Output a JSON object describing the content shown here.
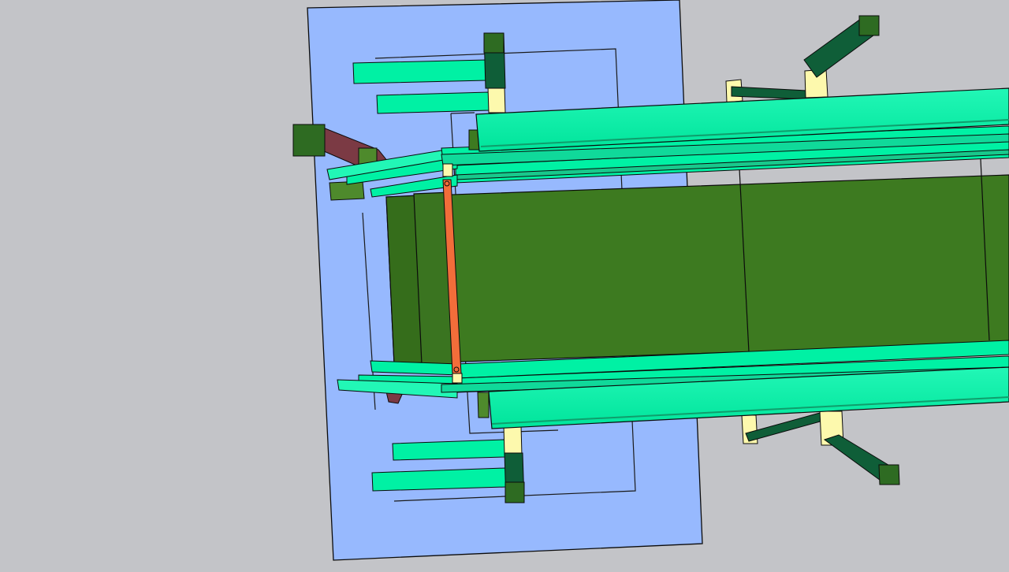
{
  "scene": {
    "background_color": "#c3c4c8",
    "colors": {
      "base_plate": "#97b9fe",
      "belt": "#3d7a20",
      "rail": "#00f1a4",
      "post": "#0f5e38",
      "post_cap": "#2e6b22",
      "post_sleeve": "#fdf9ad",
      "bracket": "#7b3a44",
      "roller_bar": "#f26d3a",
      "outline": "#0b0b0b"
    },
    "components": [
      "base-plate",
      "conveyor-belt",
      "side-rails",
      "support-posts",
      "mounting-brackets",
      "end-roller"
    ]
  }
}
